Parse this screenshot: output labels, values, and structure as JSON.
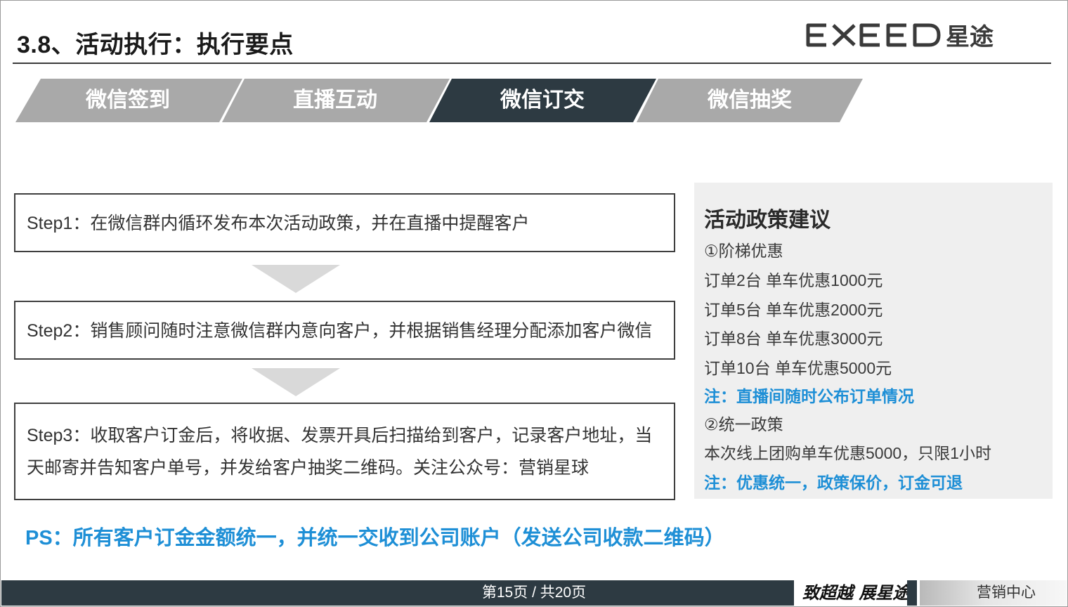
{
  "header": {
    "title": "3.8、活动执行：执行要点",
    "logo_text": "EXEED星途"
  },
  "tabs": [
    {
      "label": "微信签到",
      "active": false
    },
    {
      "label": "直播互动",
      "active": false
    },
    {
      "label": "微信订交",
      "active": true
    },
    {
      "label": "微信抽奖",
      "active": false
    }
  ],
  "steps": [
    {
      "lines": [
        "Step1：在微信群内循环发布本次活动政策，并在直播中提醒客户"
      ]
    },
    {
      "lines": [
        "Step2：销售顾问随时注意微信群内意向客户，并根据销售经理分配添加客户微信"
      ]
    },
    {
      "lines": [
        "Step3：收取客户订金后，将收据、发票开具后扫描给到客户，记录客户地址，当",
        "天邮寄并告知客户单号，并发给客户抽奖二维码。关注公众号：营销星球"
      ]
    }
  ],
  "policy": {
    "heading": "活动政策建议",
    "tier_title": "①阶梯优惠",
    "tiers": [
      "订单2台 单车优惠1000元",
      "订单5台 单车优惠2000元",
      "订单8台 单车优惠3000元",
      "订单10台  单车优惠5000元"
    ],
    "note1": "注：直播间随时公布订单情况",
    "unified_title": "②统一政策",
    "unified_text": "本次线上团购单车优惠5000，只限1小时",
    "note2": "注：优惠统一，政策保价，订金可退"
  },
  "ps": "PS：所有客户订金金额统一，并统一交收到公司账户（发送公司收款二维码）",
  "footer": {
    "page_indicator": "第15页 / 共20页",
    "slogan": "致超越 展星途",
    "department": "营销中心"
  },
  "colors": {
    "tab_inactive": "#a9a9a9",
    "tab_active": "#2d3a42",
    "accent_blue": "#1e8fd6",
    "footer_dark": "#2d3a42",
    "arrow_gray": "#d9d9d9",
    "panel_gray": "#efefef"
  }
}
